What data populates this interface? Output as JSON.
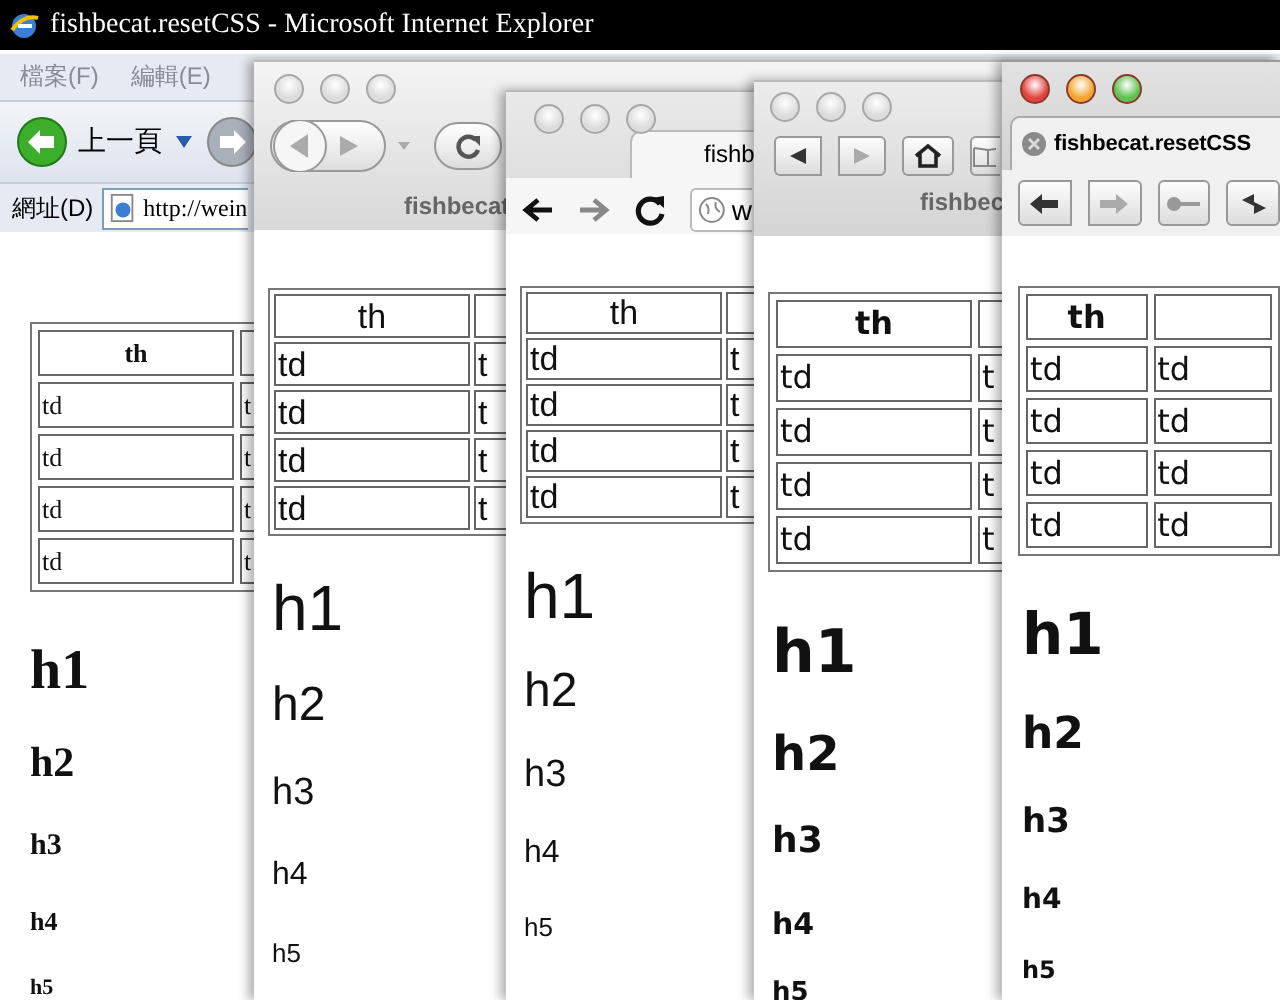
{
  "windows": [
    {
      "kind": "ie",
      "title": "fishbecat.resetCSS - Microsoft Internet Explorer",
      "menus": [
        "檔案(F)",
        "編輯(E)"
      ],
      "back_label": "上一頁",
      "address_label": "網址(D)",
      "address": "http://wein",
      "table": {
        "header": "th",
        "rows": [
          [
            "td",
            "t"
          ],
          [
            "td",
            "t"
          ],
          [
            "td",
            "t"
          ],
          [
            "td",
            "t"
          ]
        ]
      },
      "headings": [
        {
          "kind": "h1",
          "text": "h1"
        },
        {
          "kind": "h2",
          "text": "h2"
        },
        {
          "kind": "h3",
          "text": "h3"
        },
        {
          "kind": "h4",
          "text": "h4"
        },
        {
          "kind": "h5",
          "text": "h5"
        }
      ]
    },
    {
      "kind": "safari-old",
      "title": "fishbecat",
      "table": {
        "header": "th",
        "rows": [
          [
            "td",
            "t"
          ],
          [
            "td",
            "t"
          ],
          [
            "td",
            "t"
          ],
          [
            "td",
            "t"
          ]
        ]
      },
      "headings": [
        {
          "kind": "h1",
          "text": "h1"
        },
        {
          "kind": "h2",
          "text": "h2"
        },
        {
          "kind": "h3",
          "text": "h3"
        },
        {
          "kind": "h4",
          "text": "h4"
        },
        {
          "kind": "h5",
          "text": "h5"
        }
      ]
    },
    {
      "kind": "chrome",
      "tab": "fishb",
      "address": "w",
      "table": {
        "header": "th",
        "rows": [
          [
            "td",
            "t"
          ],
          [
            "td",
            "t"
          ],
          [
            "td",
            "t"
          ],
          [
            "td",
            "t"
          ]
        ]
      },
      "headings": [
        {
          "kind": "h1",
          "text": "h1"
        },
        {
          "kind": "h2",
          "text": "h2"
        },
        {
          "kind": "h3",
          "text": "h3"
        },
        {
          "kind": "h4",
          "text": "h4"
        },
        {
          "kind": "h5",
          "text": "h5"
        }
      ]
    },
    {
      "kind": "safari",
      "title": "fishbec",
      "table": {
        "header": "th",
        "rows": [
          [
            "td",
            "t"
          ],
          [
            "td",
            "t"
          ],
          [
            "td",
            "t"
          ],
          [
            "td",
            "t"
          ]
        ]
      },
      "headings": [
        {
          "kind": "h1",
          "text": "h1"
        },
        {
          "kind": "h2",
          "text": "h2"
        },
        {
          "kind": "h3",
          "text": "h3"
        },
        {
          "kind": "h4",
          "text": "h4"
        },
        {
          "kind": "h5",
          "text": "h5"
        }
      ]
    },
    {
      "kind": "firefox",
      "tab": "fishbecat.resetCSS",
      "table": {
        "header": "th",
        "rows": [
          [
            "td",
            "td"
          ],
          [
            "td",
            "td"
          ],
          [
            "td",
            "td"
          ],
          [
            "td",
            "td"
          ]
        ]
      },
      "headings": [
        {
          "kind": "h1",
          "text": "h1"
        },
        {
          "kind": "h2",
          "text": "h2"
        },
        {
          "kind": "h3",
          "text": "h3"
        },
        {
          "kind": "h4",
          "text": "h4"
        },
        {
          "kind": "h5",
          "text": "h5"
        }
      ]
    }
  ]
}
